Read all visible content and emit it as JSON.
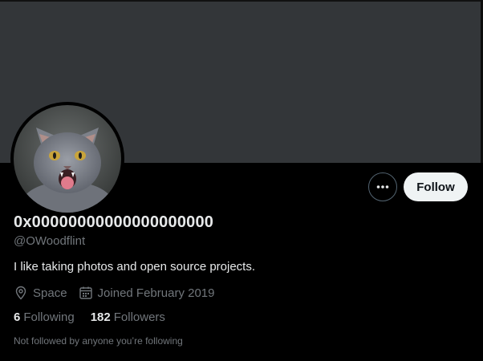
{
  "profile": {
    "display_name": "0x00000000000000000000",
    "handle": "@OWoodflint",
    "bio": "I like taking photos and open source projects.",
    "location": "Space",
    "joined": "Joined February 2019",
    "following_count": "6",
    "following_label": "Following",
    "followers_count": "182",
    "followers_label": "Followers",
    "not_followed_note": "Not followed by anyone you’re following"
  },
  "actions": {
    "follow_label": "Follow",
    "more_icon": "more-horizontal-icon"
  },
  "colors": {
    "background": "#000000",
    "banner": "#333639",
    "text_primary": "#e7e9ea",
    "text_secondary": "#71767b",
    "follow_button_bg": "#eff3f4"
  }
}
